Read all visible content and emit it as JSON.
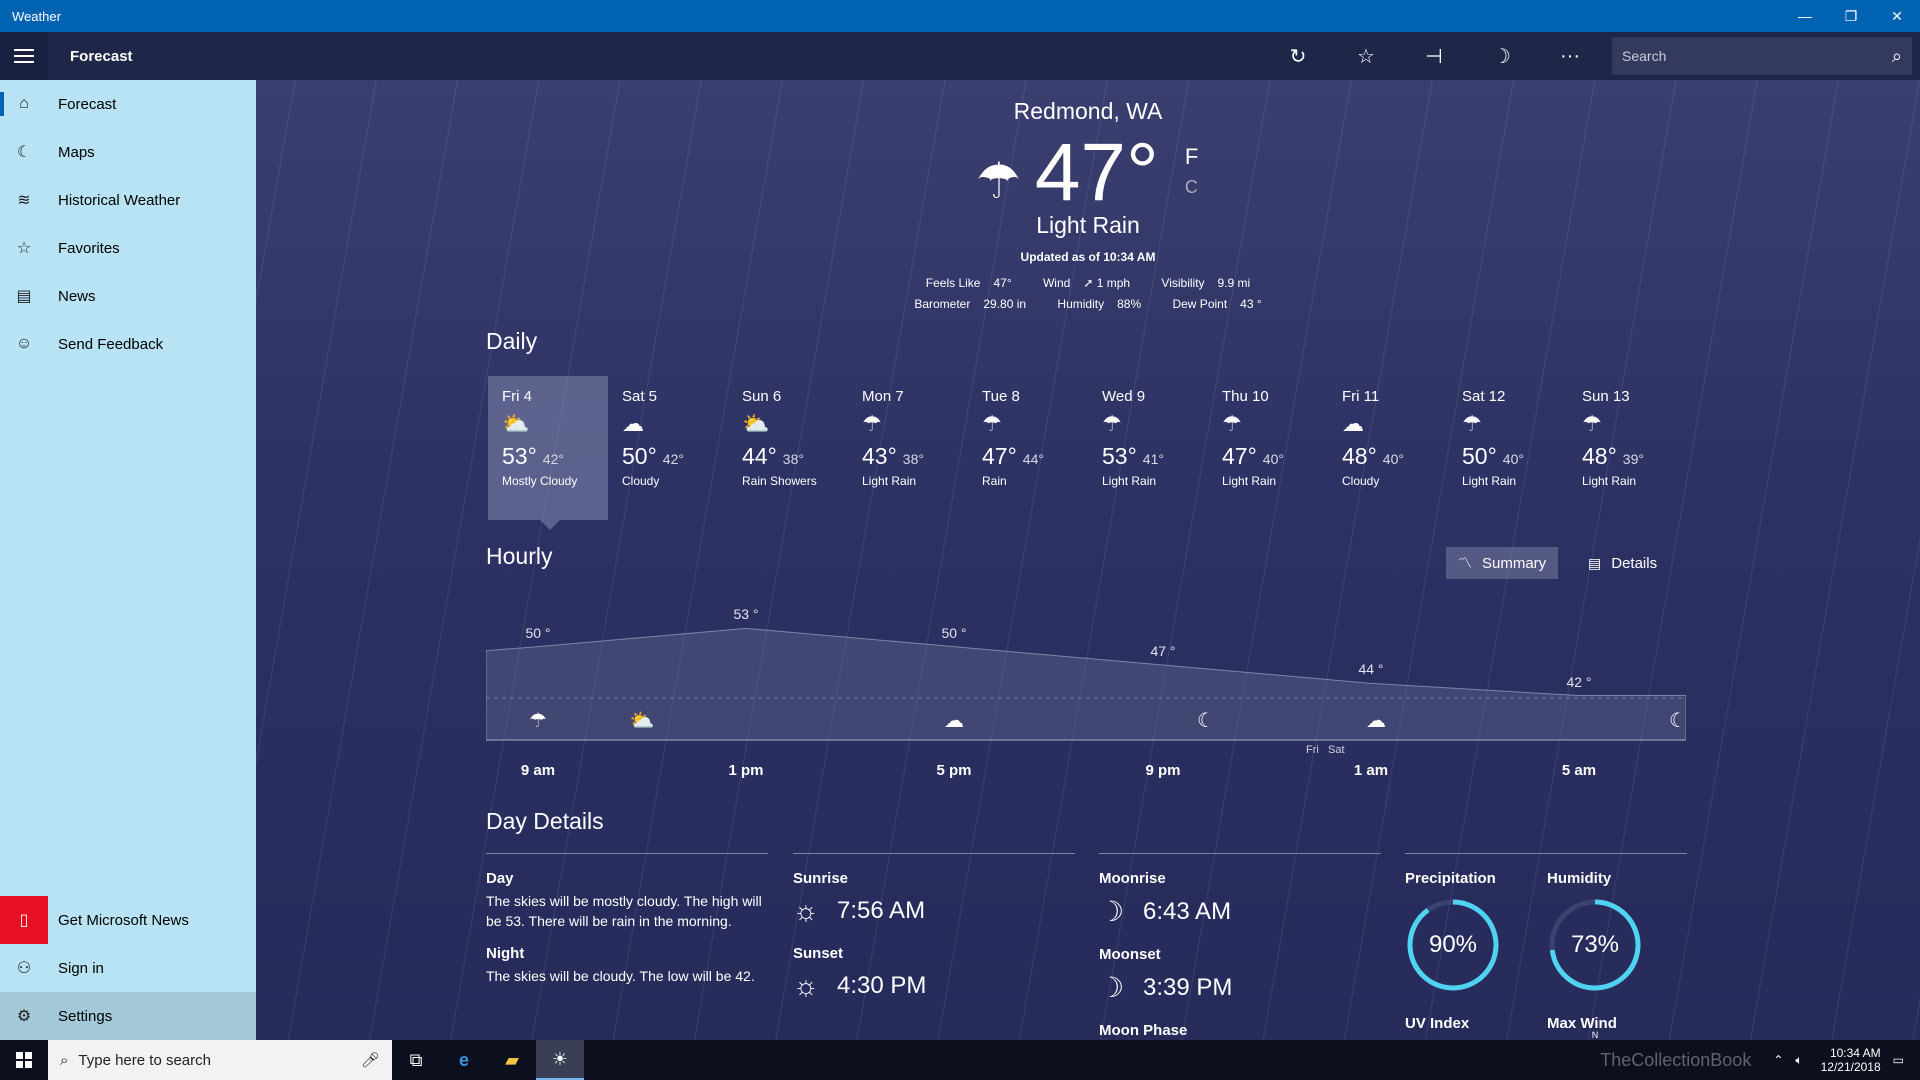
{
  "window": {
    "title": "Weather",
    "minimize": "—",
    "restore": "❐",
    "close": "✕"
  },
  "header": {
    "title": "Forecast",
    "search_placeholder": "Search"
  },
  "sidebar": {
    "items": [
      {
        "label": "Forecast",
        "icon": "⌂"
      },
      {
        "label": "Maps",
        "icon": "☾"
      },
      {
        "label": "Historical Weather",
        "icon": "≋"
      },
      {
        "label": "Favorites",
        "icon": "☆"
      },
      {
        "label": "News",
        "icon": "▤"
      },
      {
        "label": "Send Feedback",
        "icon": "☺"
      }
    ],
    "bottom": [
      {
        "label": "Get Microsoft News",
        "icon": "▯"
      },
      {
        "label": "Sign in",
        "icon": "⚇"
      },
      {
        "label": "Settings",
        "icon": "⚙"
      }
    ]
  },
  "current": {
    "city": "Redmond, WA",
    "temp": "47°",
    "unit_f": "F",
    "unit_c": "C",
    "condition": "Light Rain",
    "updated": "Updated as of 10:34 AM",
    "feels_like_label": "Feels Like",
    "feels_like": "47°",
    "wind_label": "Wind",
    "wind": "➚ 1 mph",
    "visibility_label": "Visibility",
    "visibility": "9.9 mi",
    "barometer_label": "Barometer",
    "barometer": "29.80 in",
    "humidity_label": "Humidity",
    "humidity": "88%",
    "dewpoint_label": "Dew Point",
    "dewpoint": "43 °"
  },
  "daily": {
    "title": "Daily",
    "days": [
      {
        "name": "Fri 4",
        "icon": "⛅",
        "hi": "53°",
        "lo": "42°",
        "cond": "Mostly Cloudy"
      },
      {
        "name": "Sat 5",
        "icon": "☁",
        "hi": "50°",
        "lo": "42°",
        "cond": "Cloudy"
      },
      {
        "name": "Sun 6",
        "icon": "⛅",
        "hi": "44°",
        "lo": "38°",
        "cond": "Rain Showers"
      },
      {
        "name": "Mon 7",
        "icon": "☂",
        "hi": "43°",
        "lo": "38°",
        "cond": "Light Rain"
      },
      {
        "name": "Tue 8",
        "icon": "☂",
        "hi": "47°",
        "lo": "44°",
        "cond": "Rain"
      },
      {
        "name": "Wed 9",
        "icon": "☂",
        "hi": "53°",
        "lo": "41°",
        "cond": "Light Rain"
      },
      {
        "name": "Thu 10",
        "icon": "☂",
        "hi": "47°",
        "lo": "40°",
        "cond": "Light Rain"
      },
      {
        "name": "Fri 11",
        "icon": "☁",
        "hi": "48°",
        "lo": "40°",
        "cond": "Cloudy"
      },
      {
        "name": "Sat 12",
        "icon": "☂",
        "hi": "50°",
        "lo": "40°",
        "cond": "Light Rain"
      },
      {
        "name": "Sun 13",
        "icon": "☂",
        "hi": "48°",
        "lo": "39°",
        "cond": "Light Rain"
      }
    ]
  },
  "hourly": {
    "title": "Hourly",
    "summary_label": "Summary",
    "details_label": "Details",
    "fri_label": "Fri",
    "sat_label": "Sat"
  },
  "chart_data": {
    "type": "area",
    "x": [
      "9 am",
      "1 pm",
      "5 pm",
      "9 pm",
      "1 am",
      "5 am"
    ],
    "temps": [
      50,
      53,
      50,
      47,
      44,
      42
    ],
    "temp_labels": [
      "50 °",
      "53 °",
      "50 °",
      "47 °",
      "44 °",
      "42 °"
    ],
    "icons": [
      "☂",
      "⛅",
      "☁",
      "☾",
      "☁",
      "☾"
    ],
    "ylim": [
      38,
      56
    ]
  },
  "details": {
    "title": "Day Details",
    "day_label": "Day",
    "day_text": "The skies will be mostly cloudy. The high will be 53. There will be rain in the morning.",
    "night_label": "Night",
    "night_text": "The skies will be cloudy. The low will be 42.",
    "sunrise_label": "Sunrise",
    "sunrise": "7:56 AM",
    "sunset_label": "Sunset",
    "sunset": "4:30 PM",
    "moonrise_label": "Moonrise",
    "moonrise": "6:43 AM",
    "moonset_label": "Moonset",
    "moonset": "3:39 PM",
    "moonphase_label": "Moon Phase",
    "precip_label": "Precipitation",
    "precip": "90%",
    "precip_value": 0.9,
    "humidity_label": "Humidity",
    "humidity": "73%",
    "humidity_value": 0.73,
    "uv_label": "UV Index",
    "maxwind_label": "Max Wind",
    "wind_dir": "N"
  },
  "taskbar": {
    "search_placeholder": "Type here to search",
    "time": "10:34 AM",
    "date": "12/21/2018",
    "watermark": "TheCollectionBook"
  },
  "colors": {
    "titlebar": "#0063b1",
    "sidebar": "#b7e3f5",
    "accent_ring": "#4fd3f0",
    "news_red": "#e81123"
  }
}
